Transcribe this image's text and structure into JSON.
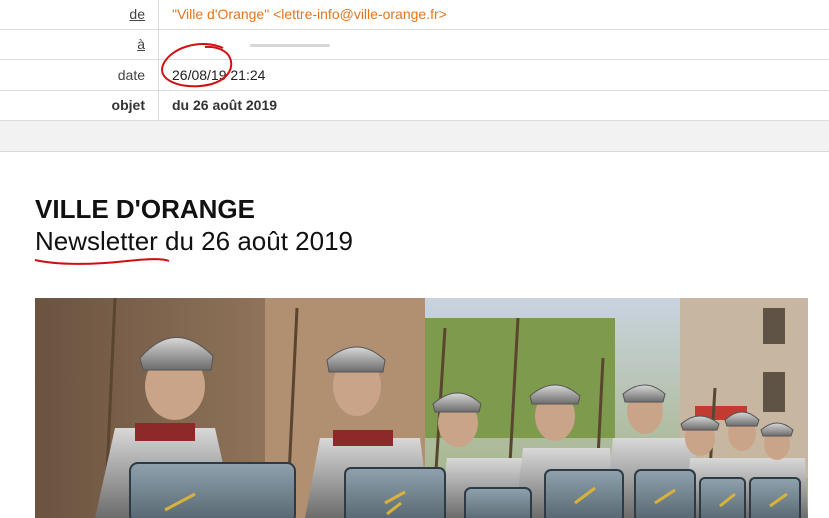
{
  "header": {
    "from_label": "de",
    "from_value": "\"Ville d'Orange\" <lettre-info@ville-orange.fr>",
    "to_label": "à",
    "date_label": "date",
    "date_value": "26/08/19 21:24",
    "subject_label": "objet",
    "subject_value": "du 26 août 2019"
  },
  "body": {
    "brand": "VILLE D'ORANGE",
    "title": "Newsletter du 26 août 2019"
  },
  "image": {
    "icon": "roman-legionaries-photo"
  },
  "colors": {
    "from_text": "#e8741a",
    "annotation": "#d01010"
  }
}
